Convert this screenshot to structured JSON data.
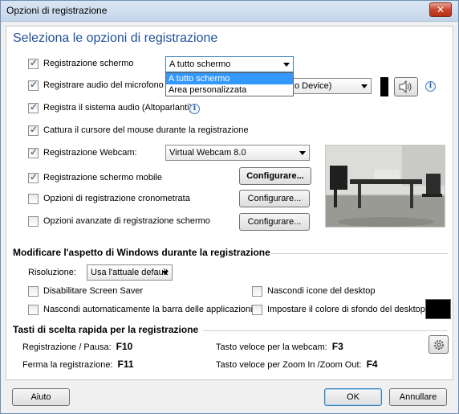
{
  "window": {
    "title": "Opzioni di registrazione",
    "close_label": "✕"
  },
  "heading": "Seleziona le opzioni di registrazione",
  "options": {
    "screen": {
      "label": "Registrazione schermo",
      "select_value": "A tutto schermo",
      "dropdown": [
        "A tutto schermo",
        "Area personalizzata"
      ]
    },
    "mic": {
      "label": "Registrare audio del microfono",
      "select_value": "o Device)"
    },
    "system_audio": {
      "label": "Registra il sistema audio (Altoparlanti)"
    },
    "cursor": {
      "label": "Cattura il cursore del mouse durante la registrazione"
    },
    "webcam": {
      "label": "Registrazione Webcam:",
      "select_value": "Virtual Webcam 8.0"
    },
    "mobile": {
      "label": "Registrazione schermo mobile",
      "button": "Configurare..."
    },
    "timed": {
      "label": "Opzioni di registrazione cronometrata",
      "button": "Configurare..."
    },
    "advanced": {
      "label": "Opzioni avanzate di registrazione schermo",
      "button": "Configurare..."
    }
  },
  "windows_section": {
    "title": "Modificare l'aspetto di Windows durante la registrazione",
    "resolution_label": "Risoluzione:",
    "resolution_value": "Usa l'attuale default",
    "disable_screensaver": "Disabilitare Screen Saver",
    "hide_taskbar": "Nascondi automaticamente la barra delle applicazioni",
    "hide_icons": "Nascondi icone del desktop",
    "bg_color_label": "Impostare il colore di sfondo del desktop:",
    "bg_color": "#000000"
  },
  "hotkeys": {
    "title": "Tasti di scelta rapida per la registrazione",
    "record_pause": {
      "label": "Registrazione / Pausa:",
      "key": "F10"
    },
    "stop": {
      "label": "Ferma la registrazione:",
      "key": "F11"
    },
    "webcam": {
      "label": "Tasto veloce per la webcam:",
      "key": "F3"
    },
    "zoom": {
      "label": "Tasto veloce per Zoom In /Zoom Out:",
      "key": "F4"
    }
  },
  "footer": {
    "help": "Aiuto",
    "ok": "OK",
    "cancel": "Annullare"
  },
  "colors": {
    "accent": "#1e4e9a",
    "selection": "#3399ff"
  }
}
